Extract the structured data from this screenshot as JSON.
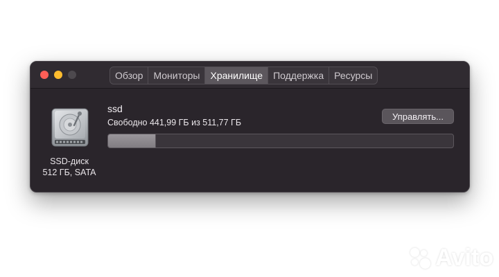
{
  "tabs": [
    {
      "label": "Обзор",
      "active": false
    },
    {
      "label": "Мониторы",
      "active": false
    },
    {
      "label": "Хранилище",
      "active": true
    },
    {
      "label": "Поддержка",
      "active": false
    },
    {
      "label": "Ресурсы",
      "active": false
    }
  ],
  "disk": {
    "icon": "hard-drive-icon",
    "name": "SSD-диск",
    "info": "512 ГБ, SATA"
  },
  "volume": {
    "name": "ssd",
    "free_text": "Свободно 441,99 ГБ из 511,77 ГБ",
    "used_fraction": 0.136,
    "manage_label": "Управлять..."
  },
  "watermark": "Avito",
  "colors": {
    "window_bg": "#2a252b",
    "close": "#ff5f57",
    "minimize": "#febc2e",
    "maximize_inactive": "#4d494e",
    "bar_fill": "#8e8a8f"
  }
}
